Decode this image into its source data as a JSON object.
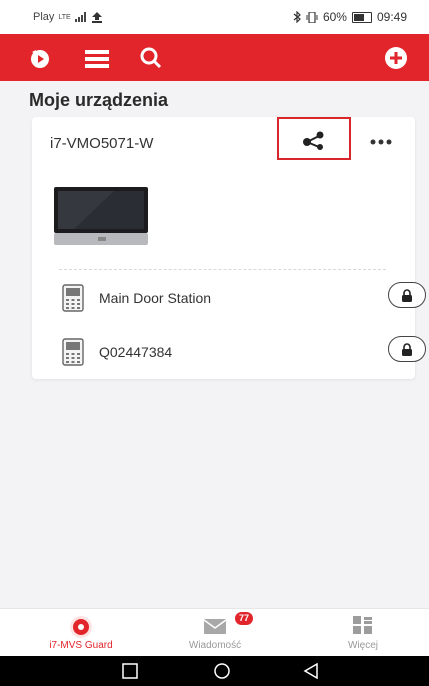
{
  "status_bar": {
    "carrier": "Play",
    "network": "LTE",
    "right_status": "60%",
    "time": "09:49"
  },
  "app_bar": {
    "icons": [
      "playback-icon",
      "list-icon",
      "search-icon",
      "add-icon"
    ],
    "color": "#e1252b"
  },
  "page": {
    "title": "Moje urządzenia"
  },
  "device_card": {
    "name": "i7-VMO5071-W",
    "highlight_color": "#d8262b",
    "sub_devices": [
      {
        "label": "Main Door Station",
        "icon": "door-station-icon",
        "action_icon": "lock-icon"
      },
      {
        "label": "Q02447384",
        "icon": "door-station-icon",
        "action_icon": "lock-icon"
      }
    ]
  },
  "bottom_nav": {
    "items": [
      {
        "label": "i7-MVS Guard",
        "icon": "guard-icon",
        "active": true
      },
      {
        "label": "Wiadomość",
        "icon": "mail-icon",
        "active": false
      },
      {
        "label": "Więcej",
        "icon": "more-grid-icon",
        "active": false
      }
    ],
    "message_badge": "77"
  },
  "system_nav": {
    "buttons": [
      "recents-icon",
      "home-icon",
      "back-icon"
    ]
  }
}
